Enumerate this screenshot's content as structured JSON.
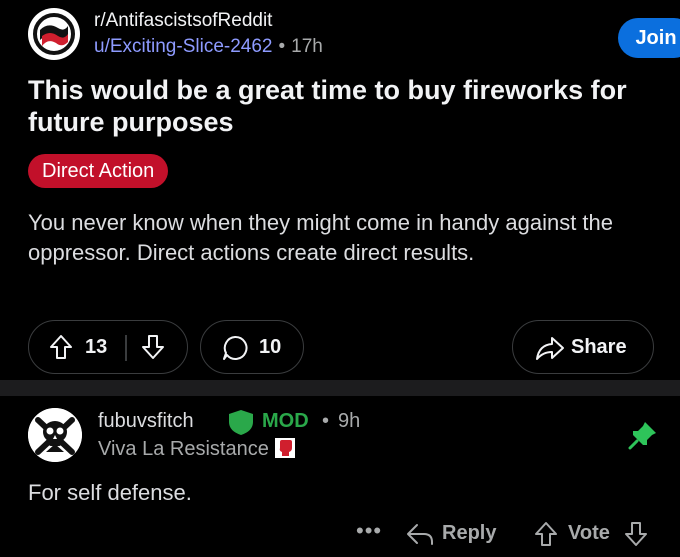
{
  "post": {
    "subreddit": "r/AntifascistsofReddit",
    "author": "u/Exciting-Slice-2462",
    "separator": "•",
    "age": "17h",
    "join_label": "Join",
    "title": "This would be a great time to buy fireworks for future purposes",
    "flair": "Direct Action",
    "body": "You never know when they might come in handy against the oppressor. Direct actions create direct results.",
    "upvotes": "13",
    "comments": "10",
    "share_label": "Share"
  },
  "comment": {
    "username": "fubuvsfitch",
    "badge": "MOD",
    "separator": "•",
    "age": "9h",
    "user_flair": "Viva La Resistance",
    "text": "For self defense.",
    "more_label": "•••",
    "reply_label": "Reply",
    "vote_label": "Vote"
  },
  "colors": {
    "background": "#000000",
    "join_blue": "#0b6fde",
    "flair_red": "#c2102a",
    "mod_green": "#2aa84a",
    "username_link": "#8e9bff"
  },
  "icons": {
    "subreddit_avatar": "antifa-flag-icon",
    "comment_avatar": "skull-crossbones-icon",
    "upvote": "arrow-up-icon",
    "downvote": "arrow-down-icon",
    "comments": "speech-bubble-icon",
    "share": "share-arrow-icon",
    "mod_badge": "shield-icon",
    "pinned": "pin-icon",
    "reply": "reply-arrow-icon",
    "flair_emoji": "raised-fist-icon"
  }
}
